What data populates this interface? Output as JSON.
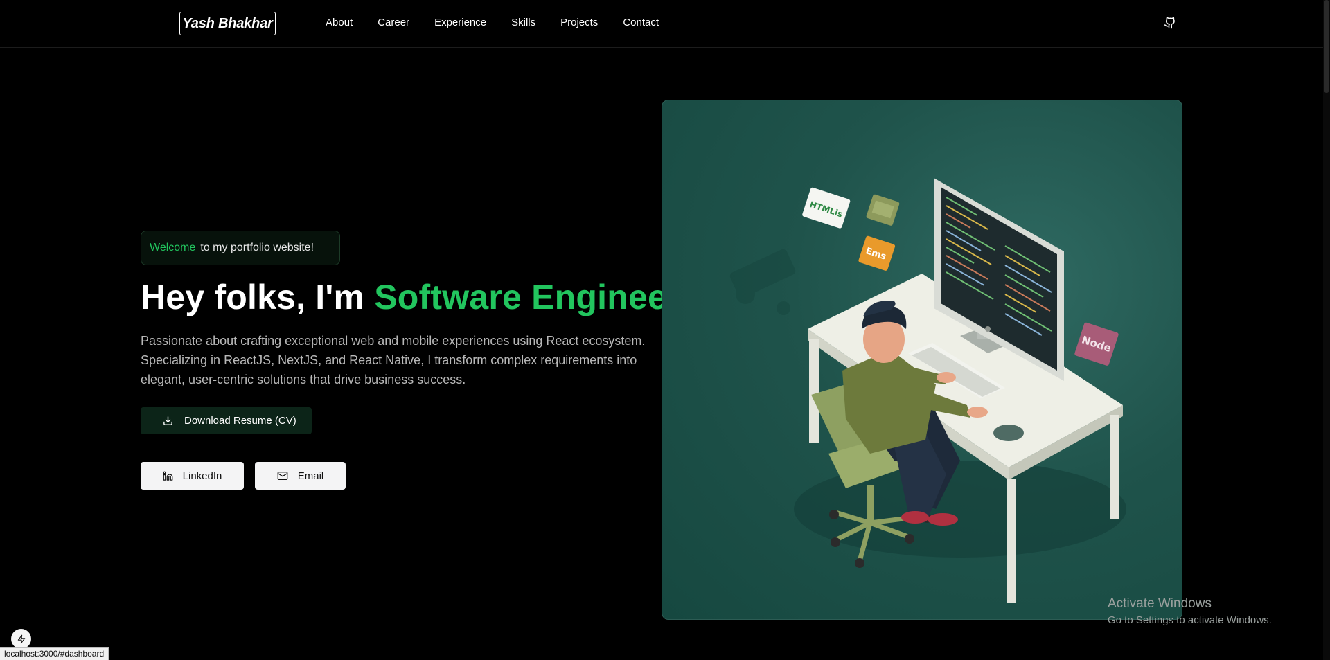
{
  "header": {
    "logo": "Yash Bhakhar",
    "nav": [
      {
        "label": "About"
      },
      {
        "label": "Career"
      },
      {
        "label": "Experience"
      },
      {
        "label": "Skills"
      },
      {
        "label": "Projects"
      },
      {
        "label": "Contact"
      }
    ],
    "github_icon": "github-icon"
  },
  "hero": {
    "badge": {
      "highlight": "Welcome",
      "text": "to my portfolio website!"
    },
    "headline": {
      "prefix": "Hey folks, I'm ",
      "accent": "Software Engineer"
    },
    "description": "Passionate about crafting exceptional web and mobile experiences using React ecosystem. Specializing in ReactJS, NextJS, and React Native, I transform complex requirements into elegant, user-centric solutions that drive business success.",
    "resume_button": "Download Resume (CV)",
    "linkedin_button": "LinkedIn",
    "email_button": "Email"
  },
  "illustration": {
    "tags": [
      "HTMLis",
      "Ems",
      "Node"
    ]
  },
  "watermark": {
    "title": "Activate Windows",
    "subtitle": "Go to Settings to activate Windows."
  },
  "status_bar": {
    "url": "localhost:3000/#dashboard"
  },
  "colors": {
    "accent": "#22c55e",
    "background": "#000000",
    "card": "#1f534b"
  }
}
